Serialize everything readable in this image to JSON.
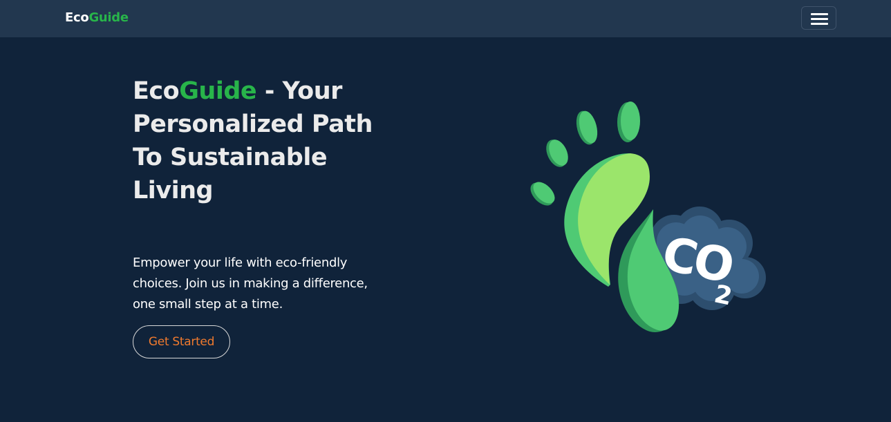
{
  "navbar": {
    "brand_eco": "Eco",
    "brand_guide": "Guide",
    "menu_icon": "hamburger-menu-icon"
  },
  "hero": {
    "title_eco": "Eco",
    "title_guide": "Guide",
    "title_rest": " - Your Personalized Path To Sustainable Living",
    "description": "Empower your life with eco-friendly choices. Join us in making a difference, one small step at a time.",
    "cta_label": "Get Started",
    "illustration": {
      "icon": "footprint-co2-icon",
      "label": "CO2"
    }
  },
  "colors": {
    "navbar_bg": "#22374f",
    "page_bg": "#10233a",
    "brand_green": "#28b54a",
    "cta_orange": "#f07a2e"
  }
}
